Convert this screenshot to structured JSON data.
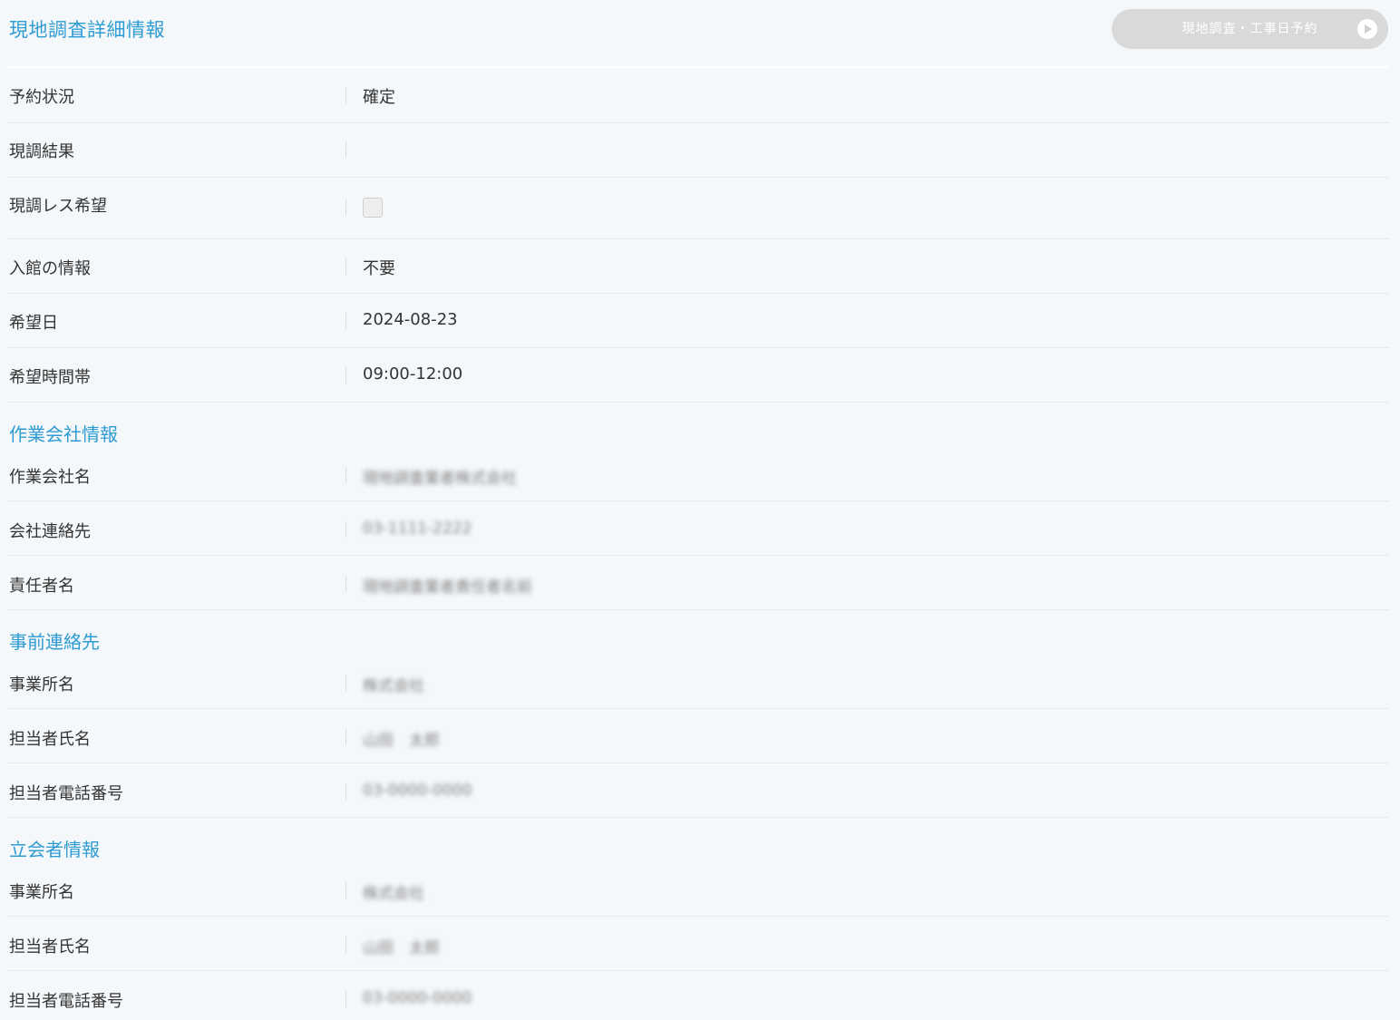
{
  "header": {
    "title": "現地調査詳細情報",
    "reserve_button_label": "現地調査・工事日予約"
  },
  "survey": {
    "rows": [
      {
        "label": "予約状況",
        "value": "確定"
      },
      {
        "label": "現調結果",
        "value": ""
      },
      {
        "label": "現調レス希望",
        "value": ""
      },
      {
        "label": "入館の情報",
        "value": "不要"
      },
      {
        "label": "希望日",
        "value": "2024-08-23"
      },
      {
        "label": "希望時間帯",
        "value": "09:00-12:00"
      }
    ],
    "genchou_less_checked": false
  },
  "company": {
    "title": "作業会社情報",
    "rows": [
      {
        "label": "作業会社名",
        "value": "現地調査業者株式会社"
      },
      {
        "label": "会社連絡先",
        "value": "03-1111-2222"
      },
      {
        "label": "責任者名",
        "value": "現地調査業者責任者名前"
      }
    ]
  },
  "advance_contact": {
    "title": "事前連絡先",
    "rows": [
      {
        "label": "事業所名",
        "value": "株式会社"
      },
      {
        "label": "担当者氏名",
        "value": "山田　太郎"
      },
      {
        "label": "担当者電話番号",
        "value": "03-0000-0000"
      }
    ]
  },
  "attendee": {
    "title": "立会者情報",
    "rows": [
      {
        "label": "事業所名",
        "value": "株式会社"
      },
      {
        "label": "担当者氏名",
        "value": "山田　太郎"
      },
      {
        "label": "担当者電話番号",
        "value": "03-0000-0000"
      }
    ]
  }
}
